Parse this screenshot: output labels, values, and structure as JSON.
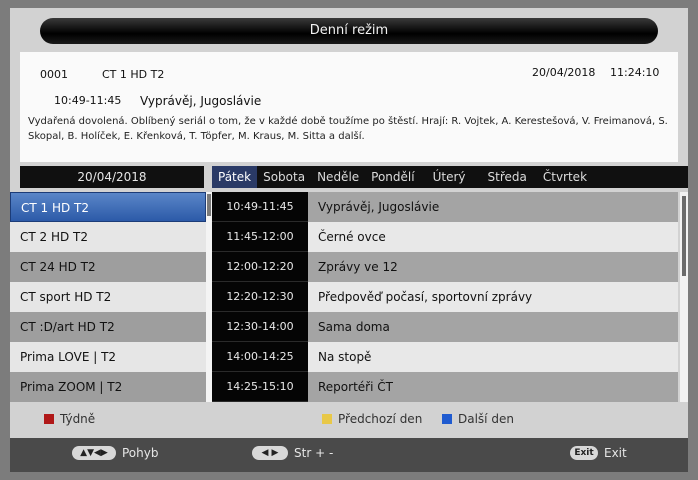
{
  "header": {
    "title": "Denní režim"
  },
  "info": {
    "channel_number": "0001",
    "channel_name": "CT 1 HD T2",
    "date": "20/04/2018",
    "time": "11:24:10",
    "event_time": "10:49-11:45",
    "event_title": "Vyprávěj, Jugoslávie",
    "description": "Vydařená dovolená. Oblíbený seriál o tom, že v každé době toužíme po štěstí. Hrají: R. Vojtek, A. Kerestešová, V. Freimanová, S. Skopal, B. Holíček, E. Křenková, T. Töpfer, M. Kraus, M. Sitta a další."
  },
  "date_selector": "20/04/2018",
  "days": [
    "Pátek",
    "Sobota",
    "Neděle",
    "Pondělí",
    "Úterý",
    "Středa",
    "Čtvrtek"
  ],
  "channels": [
    "CT 1 HD T2",
    "CT 2 HD T2",
    "CT 24 HD T2",
    "CT sport HD T2",
    "CT :D/art HD T2",
    "Prima LOVE | T2",
    "Prima ZOOM | T2"
  ],
  "events": [
    {
      "time": "10:49-11:45",
      "title": "Vyprávěj, Jugoslávie"
    },
    {
      "time": "11:45-12:00",
      "title": "Černé ovce"
    },
    {
      "time": "12:00-12:20",
      "title": "Zprávy ve 12"
    },
    {
      "time": "12:20-12:30",
      "title": "Předpověď počasí, sportovní zprávy"
    },
    {
      "time": "12:30-14:00",
      "title": "Sama doma"
    },
    {
      "time": "14:00-14:25",
      "title": "Na stopě"
    },
    {
      "time": "14:25-15:10",
      "title": "Reportéři ČT"
    }
  ],
  "legend": {
    "weekly": "Týdně",
    "prev_day": "Předchozí den",
    "next_day": "Další den",
    "colors": {
      "red": "#b01818",
      "yellow": "#e8c848",
      "blue": "#1f5bd0"
    }
  },
  "footer": {
    "move_key": "▲▼◀▶",
    "move_label": "Pohyb",
    "page_key": "◀ ▶",
    "page_label": "Str + -",
    "exit_key": "Exit",
    "exit_label": "Exit"
  }
}
